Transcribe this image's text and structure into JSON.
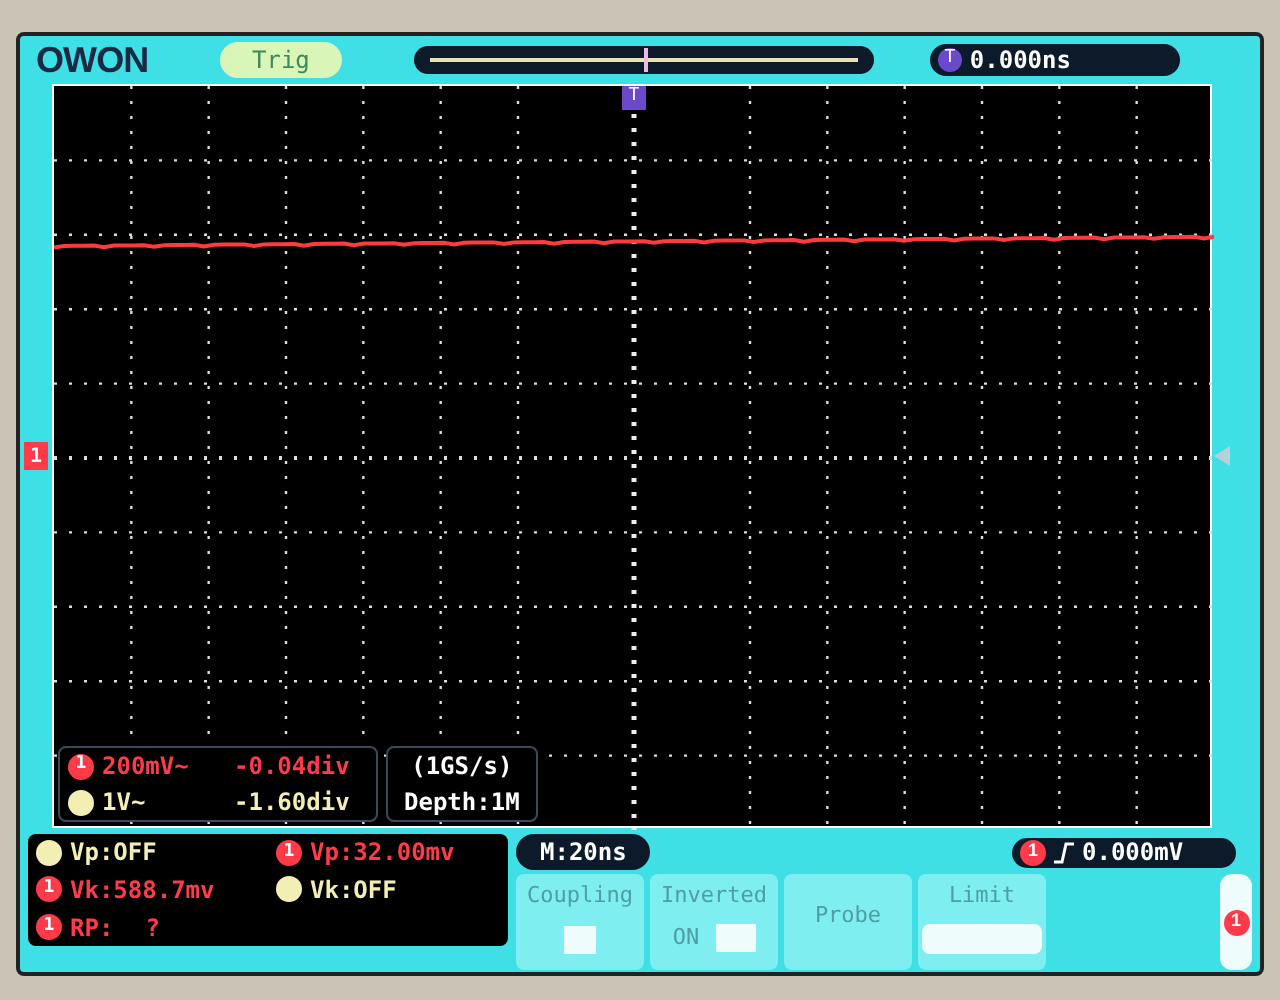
{
  "logo": "OWON",
  "trigger_status": "Trig",
  "trigger_position": {
    "level": 0.5
  },
  "trigger_time": {
    "marker": "T",
    "value": "0.000ns"
  },
  "plot": {
    "trigger_marker": "T",
    "channel_marker": "1",
    "channels": [
      {
        "badge": "1",
        "color": "#ff3b4a",
        "scale": "200mV~",
        "offset": "-0.04div"
      },
      {
        "color": "#f3efb4",
        "scale": "1V~",
        "offset": "-1.60div"
      }
    ],
    "sample_rate": "(1GS/s)",
    "depth": "Depth:1M"
  },
  "measurements": [
    {
      "color": "#f3efb4",
      "text": "Vp:OFF"
    },
    {
      "color": "#ff3b4a",
      "badge": "1",
      "text": "Vp:32.00mv"
    },
    {
      "color": "#ff3b4a",
      "badge": "1",
      "text": "Vk:588.7mv"
    },
    {
      "color": "#f3efb4",
      "text": "Vk:OFF"
    },
    {
      "color": "#ff3b4a",
      "badge": "1",
      "text": "RP:",
      "value": "?"
    }
  ],
  "timebase": "M:20ns",
  "trigger_level": {
    "badge": "1",
    "value": "0.000mV"
  },
  "menu": [
    {
      "kind": "box",
      "label": "Coupling"
    },
    {
      "kind": "toggle",
      "label": "Inverted",
      "value": "ON"
    },
    {
      "kind": "plain",
      "label": "Probe"
    },
    {
      "kind": "field",
      "label": "Limit"
    }
  ],
  "side_tab": {
    "badge": "1"
  }
}
